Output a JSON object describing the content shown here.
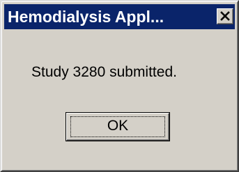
{
  "window": {
    "title": "Hemodialysis Appl...",
    "close_icon": "close-icon",
    "colors": {
      "title_bar": "#0a246a",
      "face": "#d4d0c8",
      "title_text": "#ffffff"
    }
  },
  "message": "Study 3280 submitted.",
  "buttons": {
    "ok_label": "OK"
  }
}
